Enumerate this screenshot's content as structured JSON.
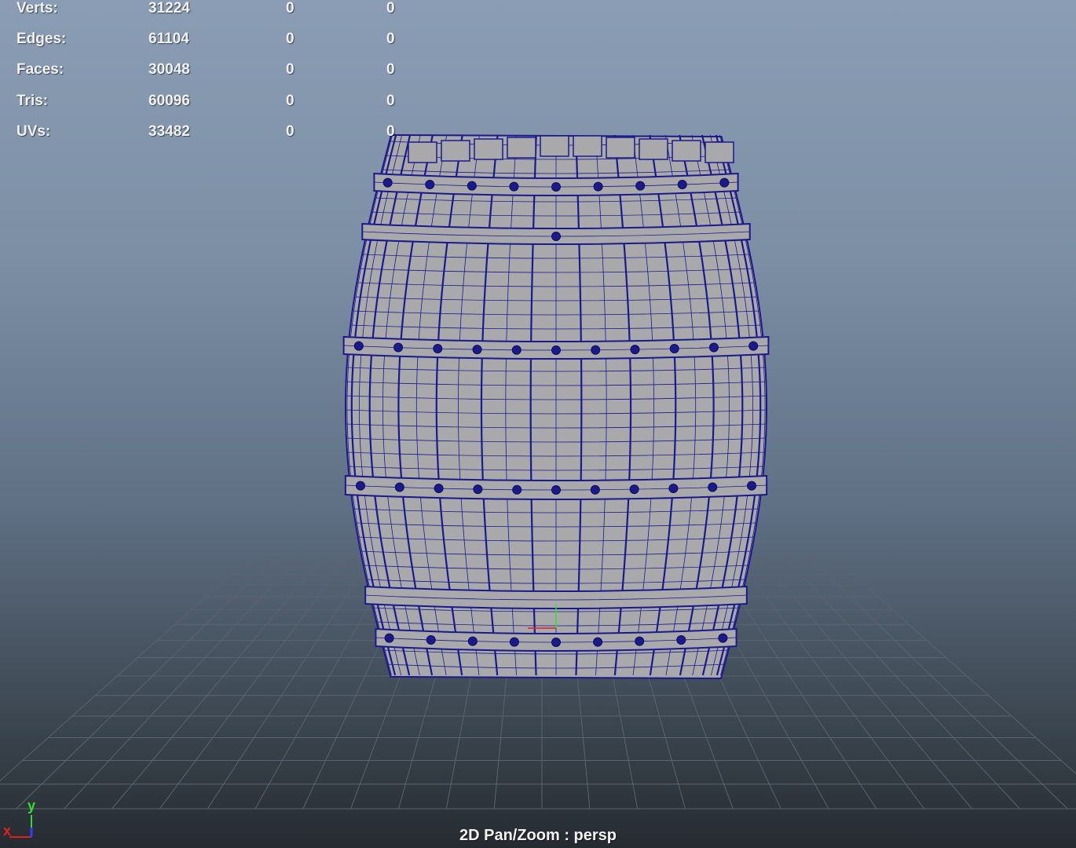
{
  "hud": {
    "rows": [
      {
        "label": "Verts:",
        "total": "31224",
        "selected": "0",
        "extra": "0"
      },
      {
        "label": "Edges:",
        "total": "61104",
        "selected": "0",
        "extra": "0"
      },
      {
        "label": "Faces:",
        "total": "30048",
        "selected": "0",
        "extra": "0"
      },
      {
        "label": "Tris:",
        "total": "60096",
        "selected": "0",
        "extra": "0"
      },
      {
        "label": "UVs:",
        "total": "33482",
        "selected": "0",
        "extra": "0"
      }
    ]
  },
  "viewport": {
    "camera_label": "2D Pan/Zoom : persp",
    "object": "barrel-wireframe",
    "grid_visible": true
  },
  "axis_gizmo": {
    "x_label": "x",
    "y_label": "y",
    "x_color": "#e02020",
    "y_color": "#2ee02e",
    "z_color": "#3a3aff"
  },
  "colors": {
    "wireframe": "#1a1a8c",
    "surface": "#a9a9ab",
    "grid": "#5a6470"
  }
}
